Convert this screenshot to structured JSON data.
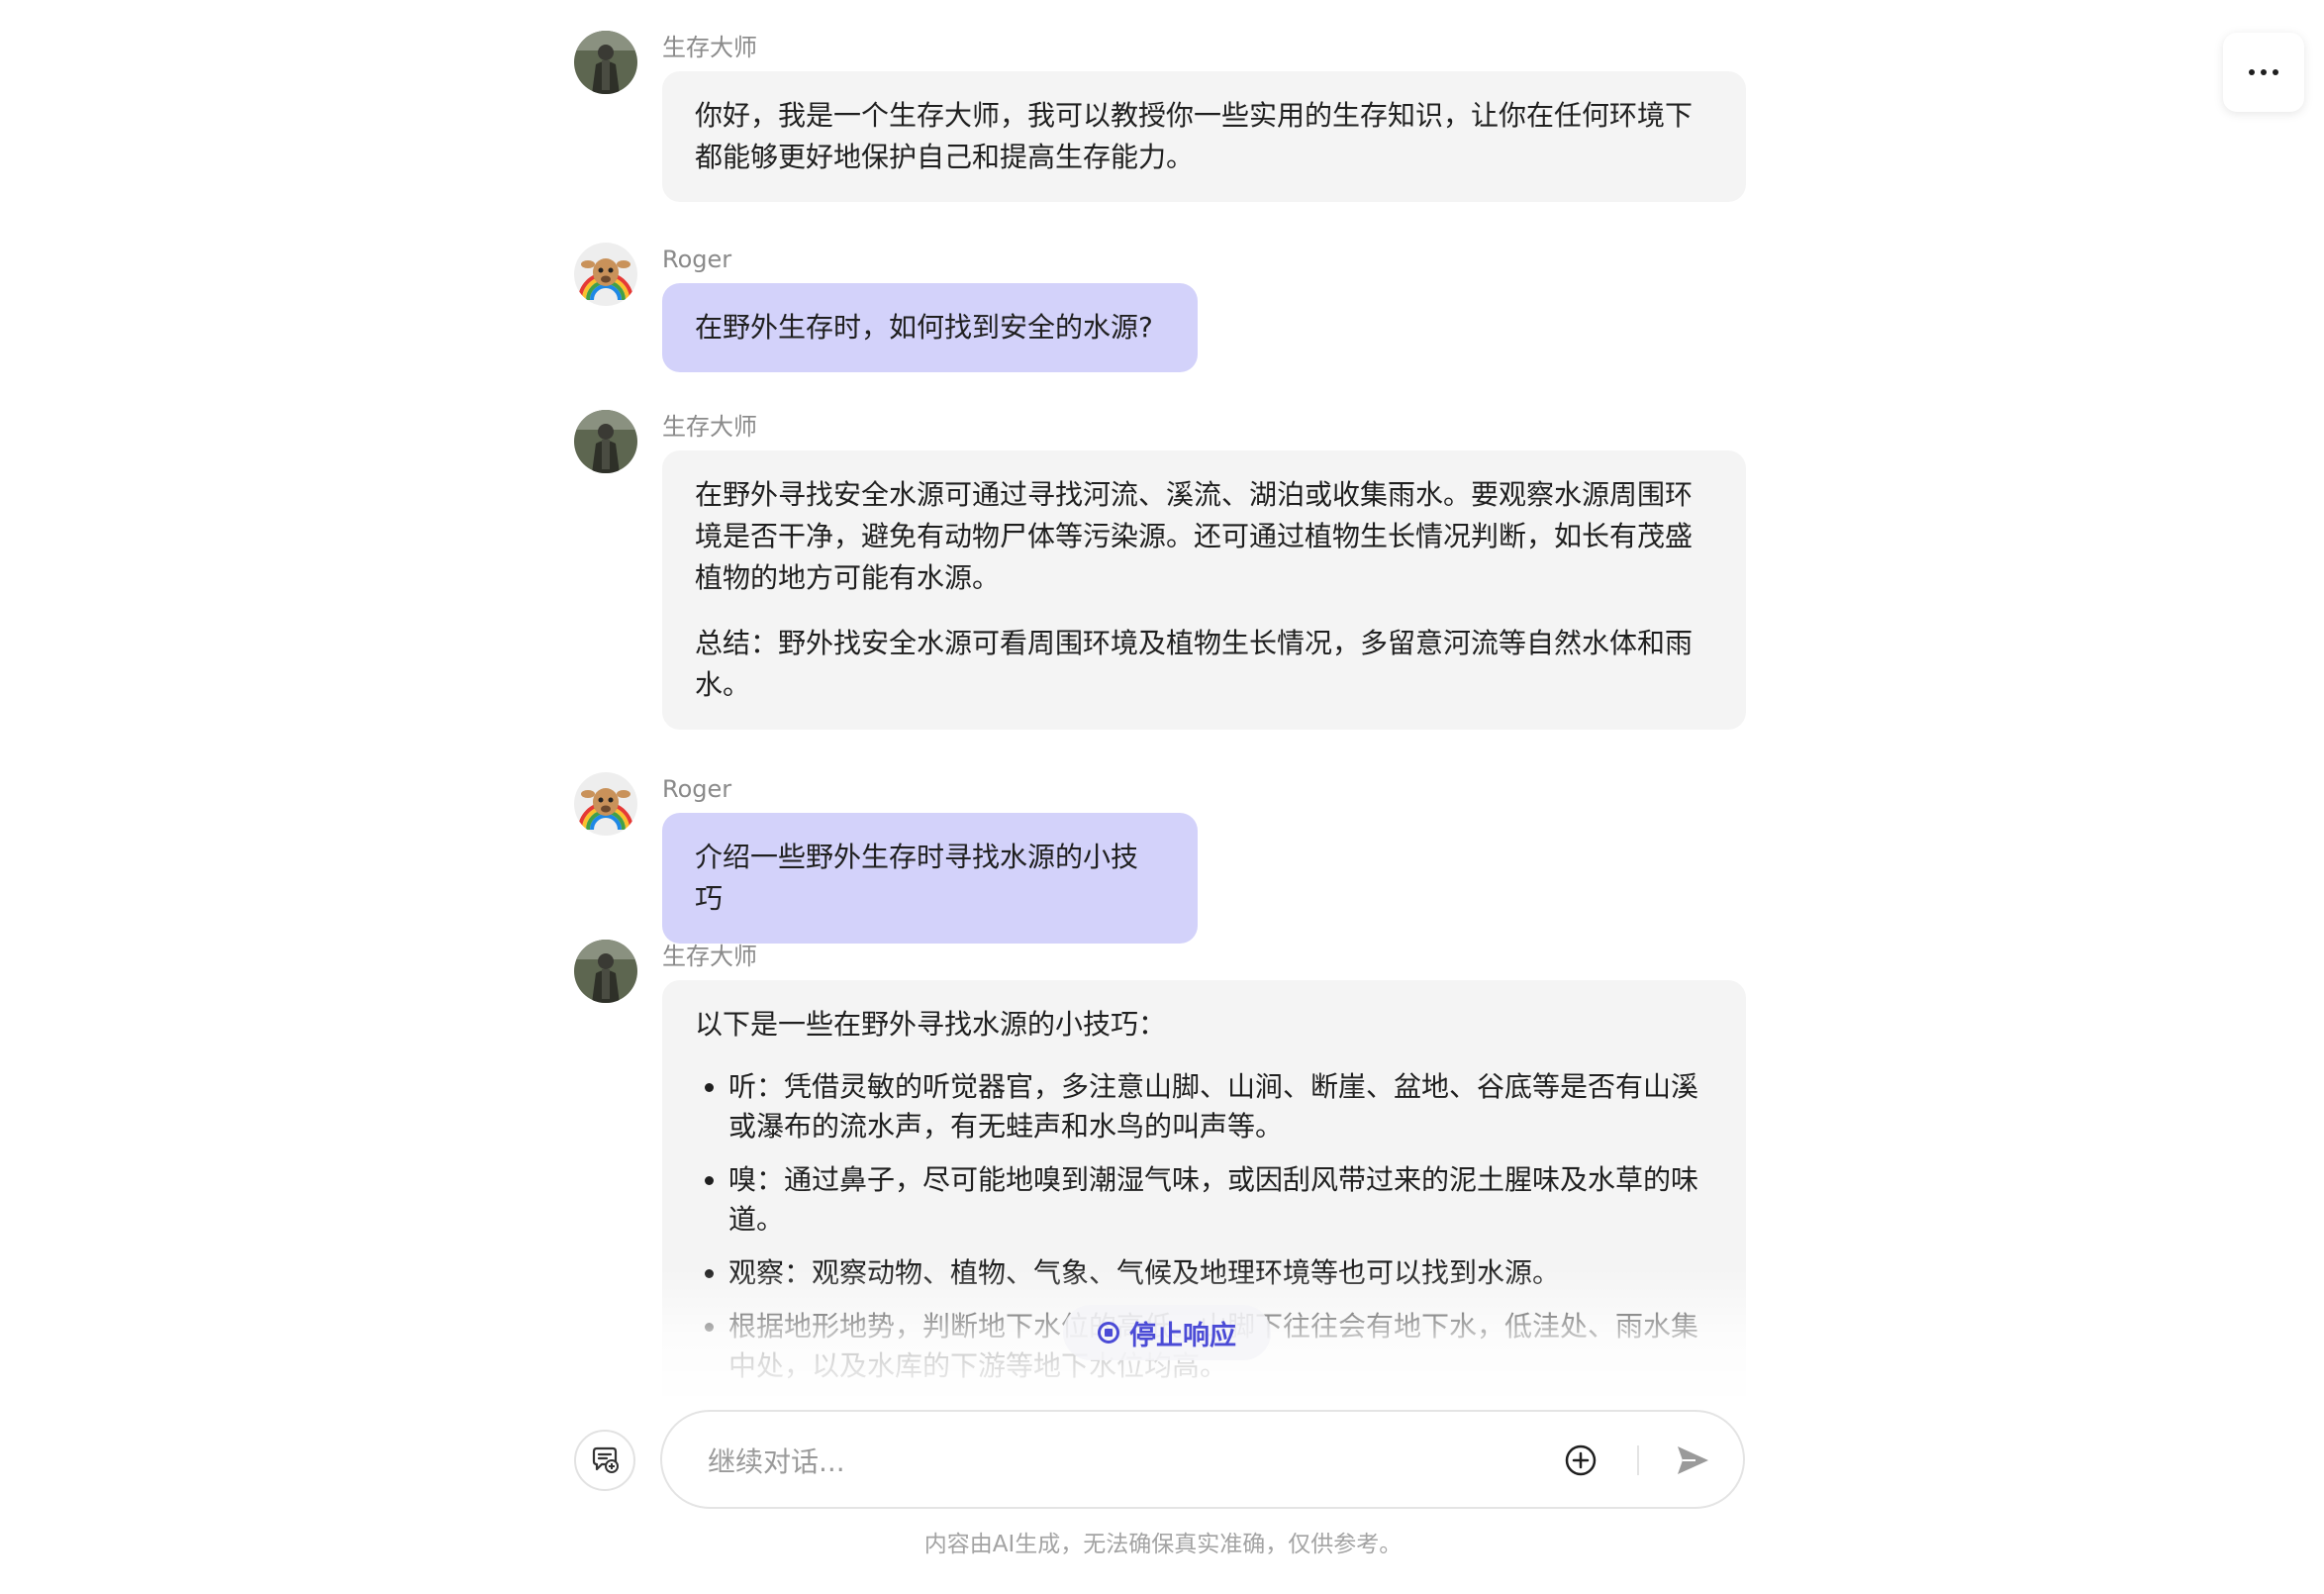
{
  "header": {
    "more_icon": "more-horizontal-icon"
  },
  "messages": [
    {
      "role": "bot",
      "sender": "生存大师",
      "paragraphs": [
        "你好，我是一个生存大师，我可以教授你一些实用的生存知识，让你在任何环境下都能够更好地保护自己和提高生存能力。"
      ]
    },
    {
      "role": "user",
      "sender": "Roger",
      "text": "在野外生存时，如何找到安全的水源?"
    },
    {
      "role": "bot",
      "sender": "生存大师",
      "paragraphs": [
        "在野外寻找安全水源可通过寻找河流、溪流、湖泊或收集雨水。要观察水源周围环境是否干净，避免有动物尸体等污染源。还可通过植物生长情况判断，如长有茂盛植物的地方可能有水源。",
        "总结：野外找安全水源可看周围环境及植物生长情况，多留意河流等自然水体和雨水。"
      ]
    },
    {
      "role": "user",
      "sender": "Roger",
      "text": "介绍一些野外生存时寻找水源的小技巧"
    },
    {
      "role": "bot",
      "sender": "生存大师",
      "intro": "以下是一些在野外寻找水源的小技巧：",
      "items": [
        "听：凭借灵敏的听觉器官，多注意山脚、山涧、断崖、盆地、谷底等是否有山溪或瀑布的流水声，有无蛙声和水鸟的叫声等。",
        "嗅：通过鼻子，尽可能地嗅到潮湿气味，或因刮风带过来的泥土腥味及水草的味道。",
        "观察：观察动物、植物、气象、气候及地理环境等也可以找到水源。",
        "根据地形地势，判断地下水位的高低。山脚下往往会有地下水，低洼处、雨水集中处，以及水库的下游等地下水位均高。"
      ]
    }
  ],
  "stop_button": {
    "label": "停止响应",
    "icon": "stop-circle-icon"
  },
  "composer": {
    "new_topic_icon": "new-topic-icon",
    "placeholder": "继续对话...",
    "value": "",
    "attach_icon": "plus-circle-icon",
    "send_icon": "send-icon"
  },
  "footer": {
    "disclaimer": "内容由AI生成，无法确保真实准确，仅供参考。"
  },
  "colors": {
    "bot_bubble": "#f4f4f4",
    "user_bubble": "#d3d2fa",
    "accent": "#4b4bd6"
  }
}
